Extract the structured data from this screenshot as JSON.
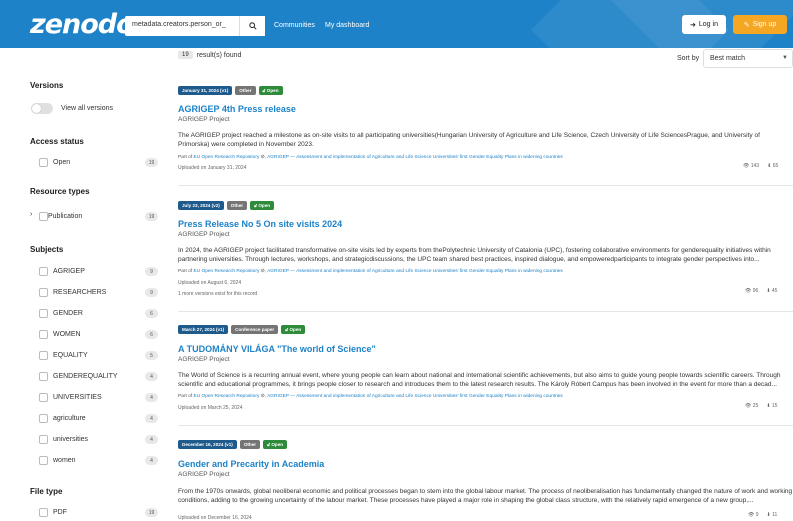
{
  "header": {
    "logo": "zenodo",
    "search_value": "metadata.creators.person_or_",
    "nav": [
      "Communities",
      "My dashboard"
    ],
    "login_label": "Log in",
    "signup_label": "Sign up"
  },
  "results": {
    "count": "19",
    "found_label": "result(s) found",
    "sort_label": "Sort by",
    "sort_value": "Best match"
  },
  "sidebar": {
    "versions": {
      "title": "Versions",
      "toggle_label": "View all versions"
    },
    "access": {
      "title": "Access status",
      "items": [
        {
          "label": "Open",
          "count": "19"
        }
      ]
    },
    "resource": {
      "title": "Resource types",
      "items": [
        {
          "label": "Publication",
          "count": "19"
        }
      ]
    },
    "subjects": {
      "title": "Subjects",
      "items": [
        {
          "label": "AGRIGEP",
          "count": "9"
        },
        {
          "label": "RESEARCHERS",
          "count": "9"
        },
        {
          "label": "GENDER",
          "count": "6"
        },
        {
          "label": "WOMEN",
          "count": "6"
        },
        {
          "label": "EQUALITY",
          "count": "5"
        },
        {
          "label": "GENDEREQUALITY",
          "count": "4"
        },
        {
          "label": "UNIVERSITIES",
          "count": "4"
        },
        {
          "label": "agriculture",
          "count": "4"
        },
        {
          "label": "universities",
          "count": "4"
        },
        {
          "label": "women",
          "count": "4"
        }
      ]
    },
    "filetype": {
      "title": "File type",
      "items": [
        {
          "label": "PDF",
          "count": "19"
        }
      ]
    }
  },
  "records": [
    {
      "date": "January 31, 2024 (v1)",
      "type": "Other",
      "access": "Open",
      "title": "AGRIGEP 4th Press release",
      "creator": "AGRIGEP Project",
      "description": "The AGRIGEP project reached a milestone as on-site visits to all participating universities(Hungarian University of Agriculture and Life Science, Czech University of Life SciencesPrague, and University of Primorska) were completed in November 2023.",
      "part_of_prefix": "Part of",
      "part_of": "EU Open Research Repository",
      "part_of_project": "AGRIGEP — Assessment and implementation of Agriculture and Life Science Universities' first Gender Equality Plans in widening countries",
      "uploaded": "Uploaded on January 31, 2024",
      "versions_note": "",
      "views": "143",
      "downloads": "65"
    },
    {
      "date": "July 23, 2024 (v2)",
      "type": "Other",
      "access": "Open",
      "title": "Press Release No 5 On site visits 2024",
      "creator": "AGRIGEP Project",
      "description": "In 2024, the AGRIGEP project facilitated transformative on-site visits led by experts from thePolytechnic University of Catalonia (UPC), fostering collaborative environments for genderequality initiatives within partnering universities. Through lectures, workshops, and strategicdiscussions, the UPC team shared best practices, inspired dialogue, and empoweredparticipants to integrate gender perspectives into...",
      "part_of_prefix": "Part of",
      "part_of": "EU Open Research Repository",
      "part_of_project": "AGRIGEP — Assessment and implementation of Agriculture and Life Science Universities' first Gender Equality Plans in widening countries",
      "uploaded": "Uploaded on August 6, 2024",
      "versions_note": "1 more versions exist for this record",
      "views": "96",
      "downloads": "45"
    },
    {
      "date": "March 27, 2024 (v1)",
      "type": "Conference paper",
      "access": "Open",
      "title": "A TUDOMÁNY VILÁGA \"The world of Science\"",
      "creator": "AGRIGEP Project",
      "description": "The World of Science is a recurring annual event, where young people can learn about national and international scientific achievements, but also aims to guide young people towards scientific careers. Through scientific and educational programmes, it brings people closer to research and introduces them to the latest research results. The Károly Róbert Campus has been involved in the event for more than a decad...",
      "part_of_prefix": "Part of",
      "part_of": "EU Open Research Repository",
      "part_of_project": "AGRIGEP — Assessment and implementation of Agriculture and Life Science Universities' first Gender Equality Plans in widening countries",
      "uploaded": "Uploaded on March 25, 2024",
      "versions_note": "",
      "views": "25",
      "downloads": "15"
    },
    {
      "date": "December 16, 2024 (v1)",
      "type": "Other",
      "access": "Open",
      "title": "Gender and Precarity in Academia",
      "creator": "AGRIGEP Project",
      "description": "From the 1970s onwards, global neoliberal economic and political processes began to stem into the global labour market. The process of neoliberalisation has fundamentally changed the nature of work and working conditions, adding to the growing uncertainty of the labour market. These processes have played a major role in shaping the global class structure, with the relatively rapid emergence of a new group,...",
      "part_of_prefix": "",
      "part_of": "",
      "part_of_project": "",
      "uploaded": "Uploaded on December 16, 2024",
      "versions_note": "",
      "views": "9",
      "downloads": "11"
    }
  ]
}
